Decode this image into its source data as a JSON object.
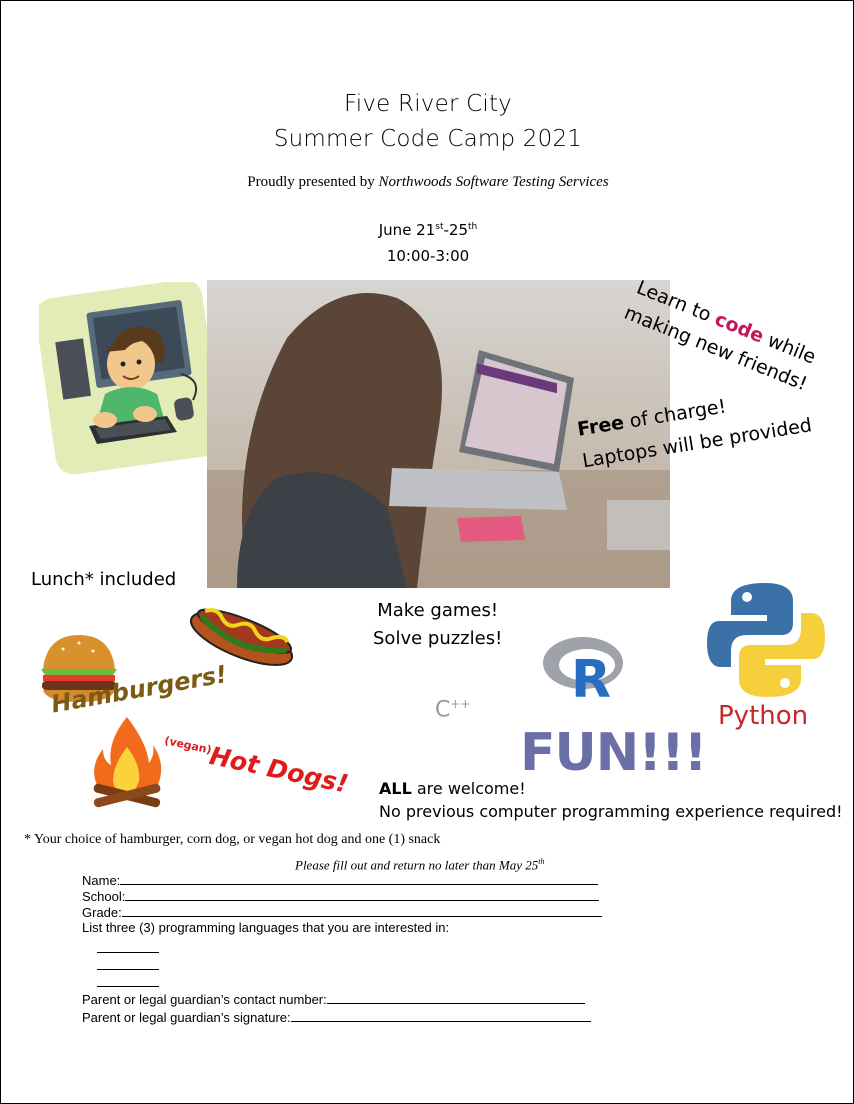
{
  "header": {
    "title_line1": "Five River City",
    "title_line2": "Summer Code Camp 2021",
    "presented_prefix": "Proudly presented by ",
    "presenter": "Northwoods Software Testing Services",
    "date_start": "June 21",
    "date_start_sup": "st",
    "date_sep": "-25",
    "date_end_sup": "th",
    "time": "10:00-3:00"
  },
  "callouts": {
    "learn_prefix": "Learn to ",
    "learn_code": "code",
    "learn_suffix": " while",
    "learn_line2": "making new friends!",
    "free_word": "Free",
    "free_rest": " of charge!",
    "laptops": "Laptops will be provided",
    "lunch": "Lunch* included",
    "make_games": "Make games!",
    "solve_puzzles": "Solve puzzles!",
    "hamburgers": "Hamburgers!",
    "vegan": "(vegan)",
    "hot_dogs": "Hot Dogs!",
    "all_word": "ALL",
    "welcome_rest": " are welcome!",
    "no_experience": "No previous computer programming experience required!"
  },
  "languages": {
    "cpp": "C",
    "cpp_sup": "++",
    "r": "R",
    "python": "Python",
    "fun": "FUN!!!"
  },
  "colors": {
    "code_accent": "#c2185b",
    "python_label": "#c62828",
    "fun": "#6b6fa8",
    "hot_dogs": "#e01b1b",
    "hamburgers": "#7a5a14",
    "python_blue": "#3a72a8",
    "python_yellow": "#f6cf3c",
    "r_blue": "#276dc2"
  },
  "icons": [
    "kid-at-computer-icon",
    "laptop-photo",
    "hot-dog-icon",
    "hamburger-icon",
    "campfire-icon",
    "r-logo-icon",
    "python-logo-icon"
  ],
  "footnote": "* Your choice of hamburger, corn dog, or vegan hot dog and one (1) snack",
  "form": {
    "return_note": "Please fill out and return no later than May 25",
    "return_note_sup": "th",
    "name_label": "Name:",
    "school_label": "School:",
    "grade_label": "Grade:",
    "languages_prompt": "List three (3) programming languages that you are interested in:",
    "contact_label": "Parent or legal guardian’s contact number:",
    "signature_label": "Parent or legal guardian’s signature:"
  }
}
